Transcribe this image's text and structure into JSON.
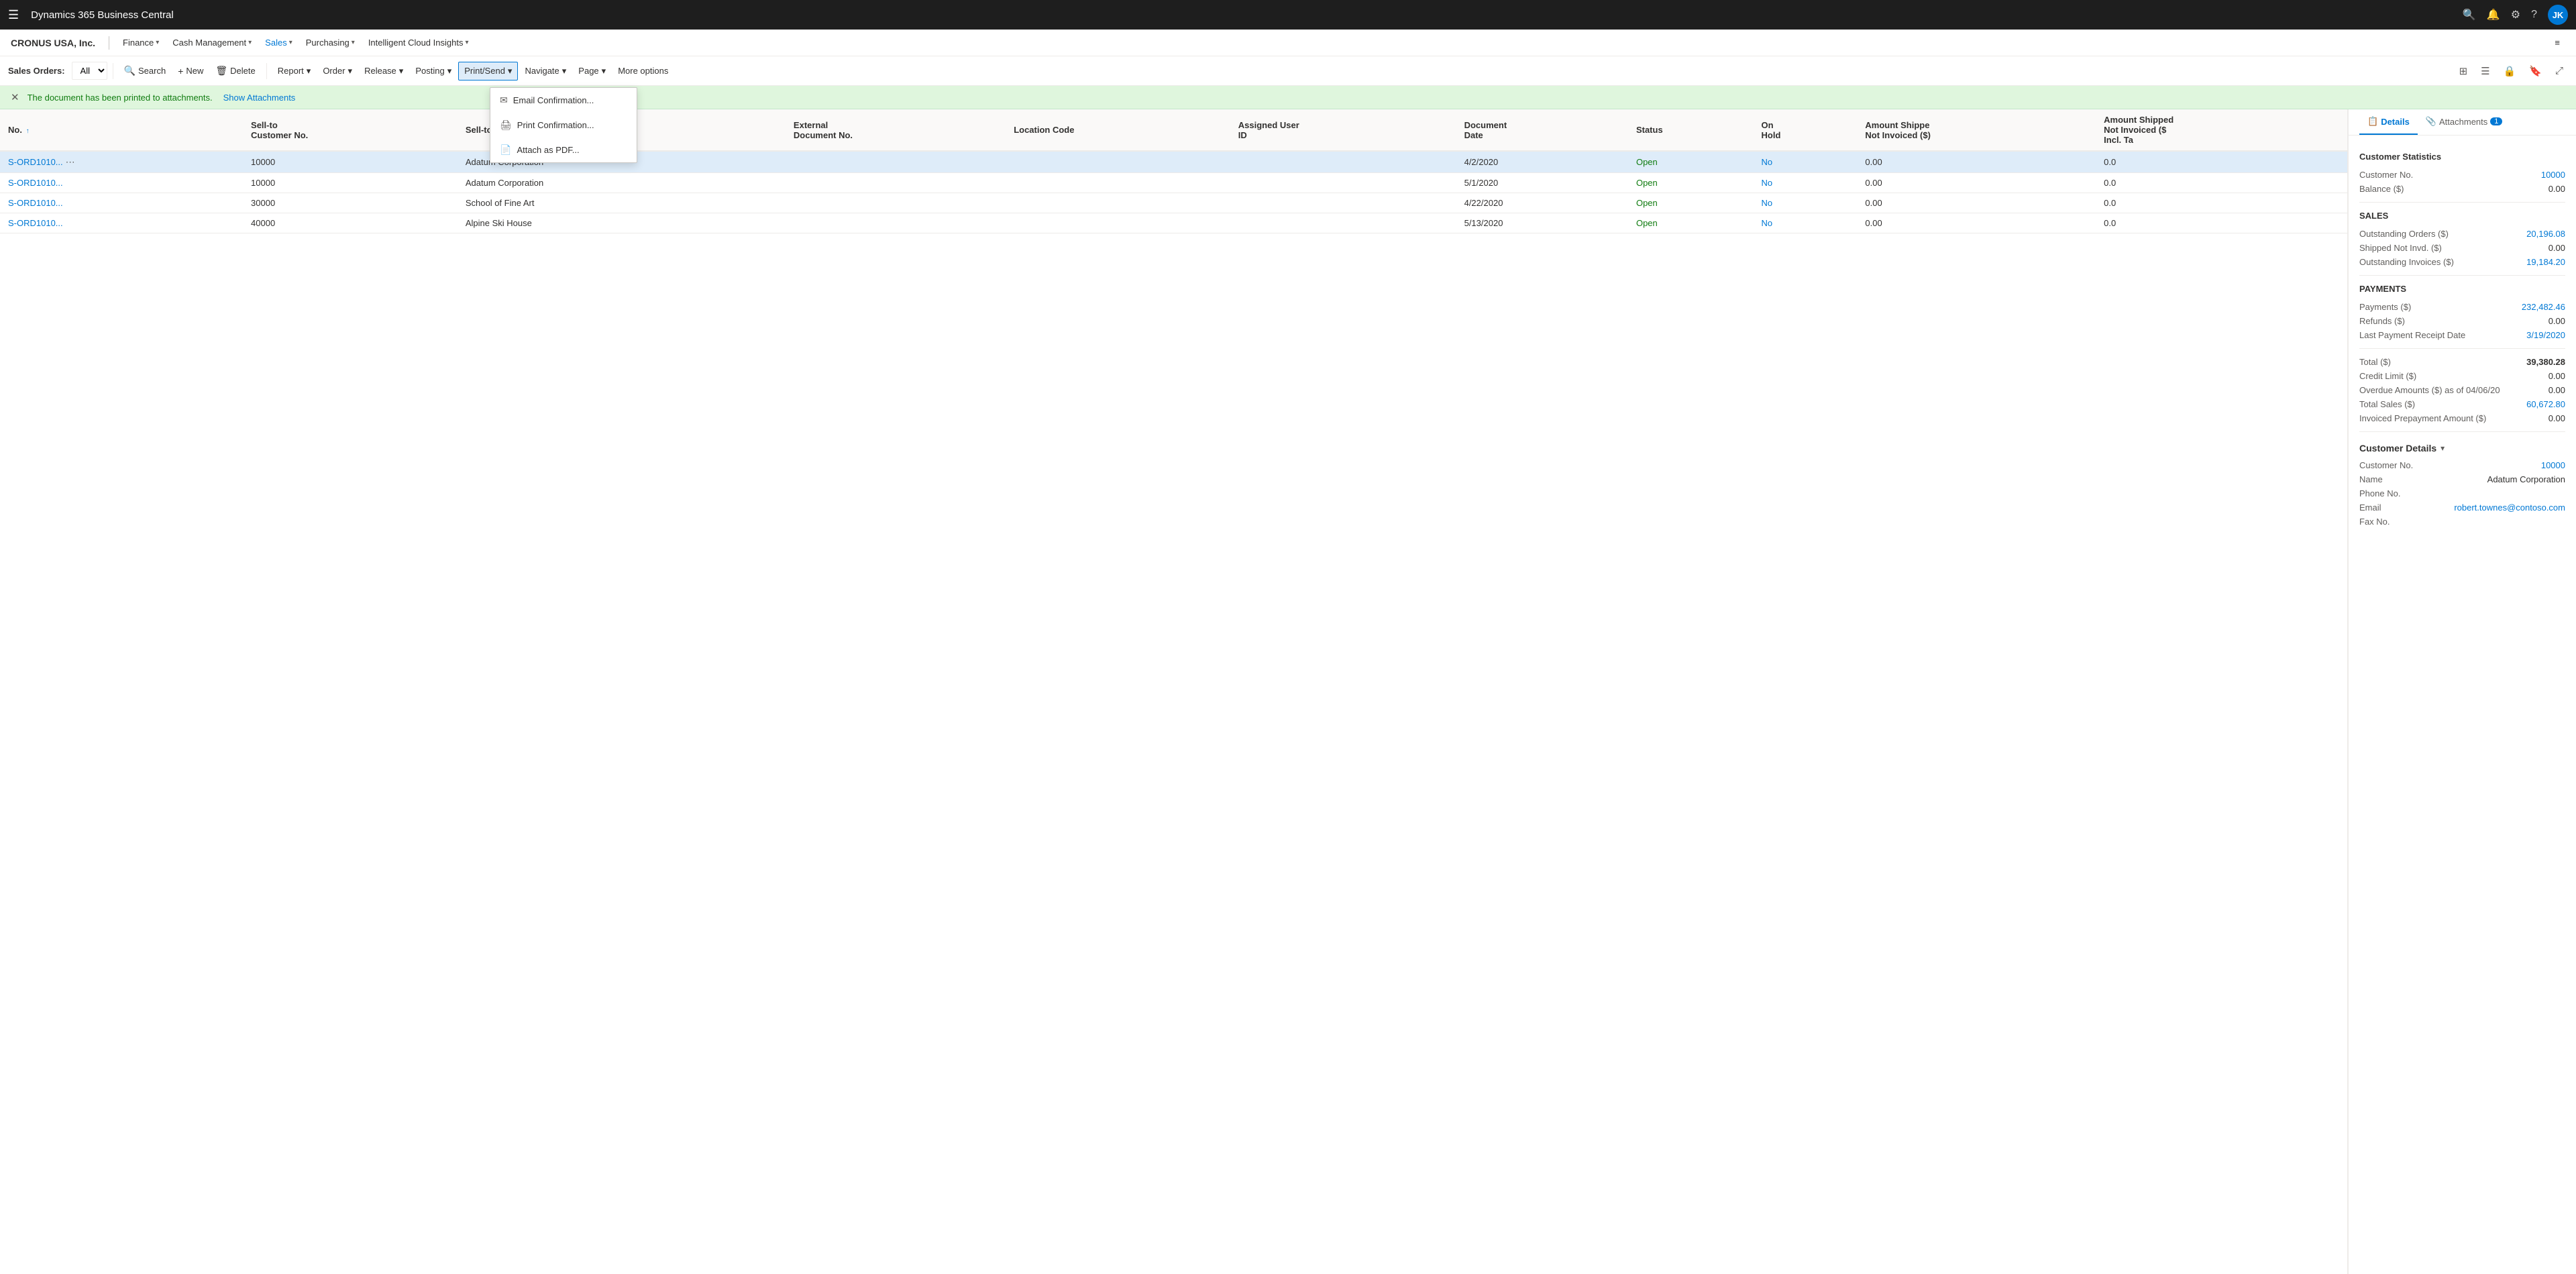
{
  "app": {
    "title": "Dynamics 365 Business Central"
  },
  "company": {
    "name": "CRONUS USA, Inc."
  },
  "nav": {
    "items": [
      {
        "label": "Finance",
        "hasChevron": true
      },
      {
        "label": "Cash Management",
        "hasChevron": true
      },
      {
        "label": "Sales",
        "hasChevron": true,
        "active": true
      },
      {
        "label": "Purchasing",
        "hasChevron": true
      },
      {
        "label": "Intelligent Cloud Insights",
        "hasChevron": true
      }
    ],
    "more_icon": "≡"
  },
  "toolbar": {
    "page_label": "Sales Orders:",
    "filter_label": "All",
    "buttons": [
      {
        "id": "search",
        "label": "Search",
        "icon": "🔍"
      },
      {
        "id": "new",
        "label": "New",
        "icon": "+"
      },
      {
        "id": "delete",
        "label": "Delete",
        "icon": "🗑"
      },
      {
        "id": "report",
        "label": "Report",
        "icon": ""
      },
      {
        "id": "order",
        "label": "Order",
        "icon": ""
      },
      {
        "id": "release",
        "label": "Release",
        "icon": ""
      },
      {
        "id": "posting",
        "label": "Posting",
        "icon": ""
      },
      {
        "id": "print_send",
        "label": "Print/Send",
        "icon": ""
      },
      {
        "id": "navigate",
        "label": "Navigate",
        "icon": ""
      },
      {
        "id": "page",
        "label": "Page",
        "icon": ""
      },
      {
        "id": "more_options",
        "label": "More options",
        "icon": ""
      }
    ]
  },
  "alert": {
    "message": "The document has been printed to attachments.",
    "link_text": "Show Attachments"
  },
  "table": {
    "columns": [
      {
        "id": "no",
        "label": "No. ↑"
      },
      {
        "id": "sell_to_customer_no",
        "label": "Sell-to Customer No."
      },
      {
        "id": "sell_to_customer_name",
        "label": "Sell-to Customer Name"
      },
      {
        "id": "external_document_no",
        "label": "External Document No."
      },
      {
        "id": "location_code",
        "label": "Location Code"
      },
      {
        "id": "assigned_user_id",
        "label": "Assigned User ID"
      },
      {
        "id": "document_date",
        "label": "Document Date"
      },
      {
        "id": "status",
        "label": "Status"
      },
      {
        "id": "on_hold",
        "label": "On Hold"
      },
      {
        "id": "amount_shipped_not_invoiced",
        "label": "Amount Shipped Not Invoiced ($)"
      },
      {
        "id": "amount_shipped_not_invoiced_incl_tax",
        "label": "Amount Shipped Not Invoiced ($ Incl. Tax)"
      }
    ],
    "rows": [
      {
        "no": "S-ORD1010...",
        "sell_to_customer_no": "10000",
        "sell_to_customer_name": "Adatum Corporation",
        "external_document_no": "",
        "location_code": "",
        "assigned_user_id": "",
        "document_date": "4/2/2020",
        "status": "Open",
        "on_hold": "No",
        "amount_shipped_not_invoiced": "0.00",
        "amount_shipped_not_invoiced_incl_tax": "0.0",
        "selected": true
      },
      {
        "no": "S-ORD1010...",
        "sell_to_customer_no": "10000",
        "sell_to_customer_name": "Adatum Corporation",
        "external_document_no": "",
        "location_code": "",
        "assigned_user_id": "",
        "document_date": "5/1/2020",
        "status": "Open",
        "on_hold": "No",
        "amount_shipped_not_invoiced": "0.00",
        "amount_shipped_not_invoiced_incl_tax": "0.0",
        "selected": false
      },
      {
        "no": "S-ORD1010...",
        "sell_to_customer_no": "30000",
        "sell_to_customer_name": "School of Fine Art",
        "external_document_no": "",
        "location_code": "",
        "assigned_user_id": "",
        "document_date": "4/22/2020",
        "status": "Open",
        "on_hold": "No",
        "amount_shipped_not_invoiced": "0.00",
        "amount_shipped_not_invoiced_incl_tax": "0.0",
        "selected": false
      },
      {
        "no": "S-ORD1010...",
        "sell_to_customer_no": "40000",
        "sell_to_customer_name": "Alpine Ski House",
        "external_document_no": "",
        "location_code": "",
        "assigned_user_id": "",
        "document_date": "5/13/2020",
        "status": "Open",
        "on_hold": "No",
        "amount_shipped_not_invoiced": "0.00",
        "amount_shipped_not_invoiced_incl_tax": "0.0",
        "selected": false
      }
    ]
  },
  "detail_panel": {
    "tabs": [
      {
        "id": "details",
        "label": "Details",
        "icon": "📋",
        "active": true
      },
      {
        "id": "attachments",
        "label": "Attachments",
        "icon": "📎",
        "badge": "1",
        "active": false
      }
    ],
    "customer_statistics": {
      "title": "Customer Statistics",
      "customer_no_label": "Customer No.",
      "customer_no_value": "10000",
      "balance_label": "Balance ($)",
      "balance_value": "0.00",
      "sales_section": "SALES",
      "outstanding_orders_label": "Outstanding Orders ($)",
      "outstanding_orders_value": "20,196.08",
      "shipped_not_invd_label": "Shipped Not Invd. ($)",
      "shipped_not_invd_value": "0.00",
      "outstanding_invoices_label": "Outstanding Invoices ($)",
      "outstanding_invoices_value": "19,184.20",
      "payments_section": "PAYMENTS",
      "payments_label": "Payments ($)",
      "payments_value": "232,482.46",
      "refunds_label": "Refunds ($)",
      "refunds_value": "0.00",
      "last_payment_receipt_label": "Last Payment Receipt Date",
      "last_payment_receipt_value": "3/19/2020",
      "total_label": "Total ($)",
      "total_value": "39,380.28",
      "credit_limit_label": "Credit Limit ($)",
      "credit_limit_value": "0.00",
      "overdue_amounts_label": "Overdue Amounts ($) as of 04/06/20",
      "overdue_amounts_value": "0.00",
      "total_sales_label": "Total Sales ($)",
      "total_sales_value": "60,672.80",
      "invoiced_prepayment_label": "Invoiced Prepayment Amount ($)",
      "invoiced_prepayment_value": "0.00"
    },
    "customer_details": {
      "title": "Customer Details",
      "customer_no_label": "Customer No.",
      "customer_no_value": "10000",
      "name_label": "Name",
      "name_value": "Adatum Corporation",
      "phone_label": "Phone No.",
      "phone_value": "",
      "email_label": "Email",
      "email_value": "robert.townes@contoso.com",
      "fax_label": "Fax No.",
      "fax_value": ""
    }
  },
  "dropdown_menu": {
    "items": [
      {
        "id": "email_confirmation",
        "label": "Email Confirmation...",
        "icon": "✉"
      },
      {
        "id": "print_confirmation",
        "label": "Print Confirmation...",
        "icon": "🖨"
      },
      {
        "id": "attach_as_pdf",
        "label": "Attach as PDF...",
        "icon": "📄"
      }
    ]
  },
  "user": {
    "initials": "JK"
  },
  "icons": {
    "hamburger": "☰",
    "search": "🔍",
    "bell": "🔔",
    "settings": "⚙",
    "help": "?",
    "filter": "⊞",
    "list_view": "☰",
    "lock": "🔒",
    "bookmark": "🔖",
    "expand": "⤢",
    "chevron_down": "▾",
    "chevron_right": "›",
    "close": "✕"
  }
}
